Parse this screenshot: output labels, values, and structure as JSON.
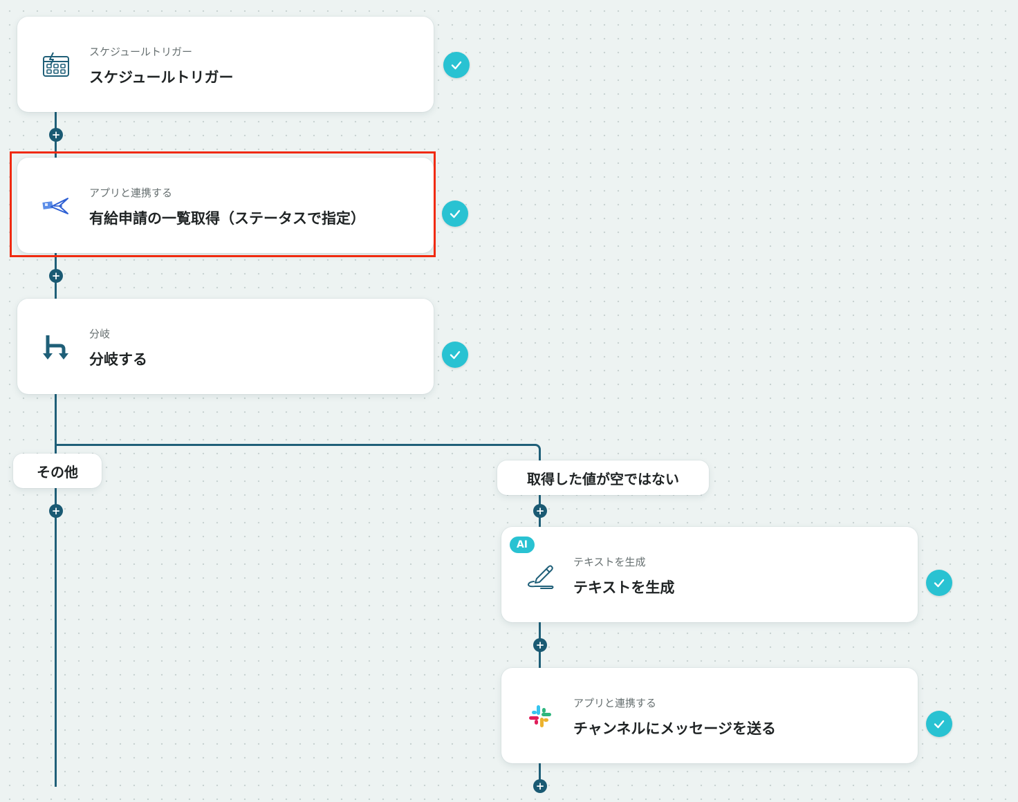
{
  "nodes": [
    {
      "subtitle": "スケジュールトリガー",
      "title": "スケジュールトリガー",
      "icon": "schedule-calendar-icon"
    },
    {
      "subtitle": "アプリと連携する",
      "title": "有給申請の一覧取得（ステータスで指定）",
      "icon": "app-bird-logo-icon"
    },
    {
      "subtitle": "分岐",
      "title": "分岐する",
      "icon": "branch-icon"
    },
    {
      "subtitle": "テキストを生成",
      "title": "テキストを生成",
      "icon": "pen-write-icon",
      "badge": "AI"
    },
    {
      "subtitle": "アプリと連携する",
      "title": "チャンネルにメッセージを送る",
      "icon": "slack-icon"
    }
  ],
  "branches": {
    "other": "その他",
    "not_empty": "取得した値が空ではない"
  },
  "colors": {
    "line": "#1f5f78",
    "check": "#29c2d2",
    "highlight": "#f02a0f"
  }
}
